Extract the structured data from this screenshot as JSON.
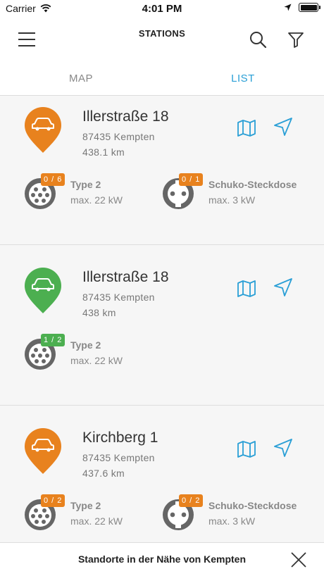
{
  "status_bar": {
    "carrier": "Carrier",
    "time": "4:01 PM"
  },
  "nav": {
    "title": "STATIONS"
  },
  "tabs": [
    {
      "label": "MAP"
    },
    {
      "label": "LIST"
    }
  ],
  "stations": [
    {
      "name": "Illerstraße 18",
      "city": "87435 Kempten",
      "distance": "438.1 km",
      "pin_color": "#e8821e",
      "plugs": [
        {
          "badge": "0 / 6",
          "badge_color": "#e8821e",
          "type": "Type 2",
          "power": "max. 22 kW",
          "socket_icon": "type2-socket-icon"
        },
        {
          "badge": "0 / 1",
          "badge_color": "#e8821e",
          "type": "Schuko-Steckdose",
          "power": "max. 3 kW",
          "socket_icon": "schuko-socket-icon"
        }
      ]
    },
    {
      "name": "Illerstraße 18",
      "city": "87435 Kempten",
      "distance": "438 km",
      "pin_color": "#4caf50",
      "plugs": [
        {
          "badge": "1 / 2",
          "badge_color": "#4caf50",
          "type": "Type 2",
          "power": "max. 22 kW",
          "socket_icon": "type2-socket-icon"
        }
      ]
    },
    {
      "name": "Kirchberg 1",
      "city": "87435 Kempten",
      "distance": "437.6 km",
      "pin_color": "#e8821e",
      "plugs": [
        {
          "badge": "0 / 2",
          "badge_color": "#e8821e",
          "type": "Type 2",
          "power": "max. 22 kW",
          "socket_icon": "type2-socket-icon"
        },
        {
          "badge": "0 / 2",
          "badge_color": "#e8821e",
          "type": "Schuko-Steckdose",
          "power": "max. 3 kW",
          "socket_icon": "schuko-socket-icon"
        }
      ]
    }
  ],
  "footer": {
    "text": "Standorte in der Nähe von Kempten"
  },
  "colors": {
    "accent": "#2a9fd6",
    "orange": "#e8821e",
    "green": "#4caf50"
  }
}
